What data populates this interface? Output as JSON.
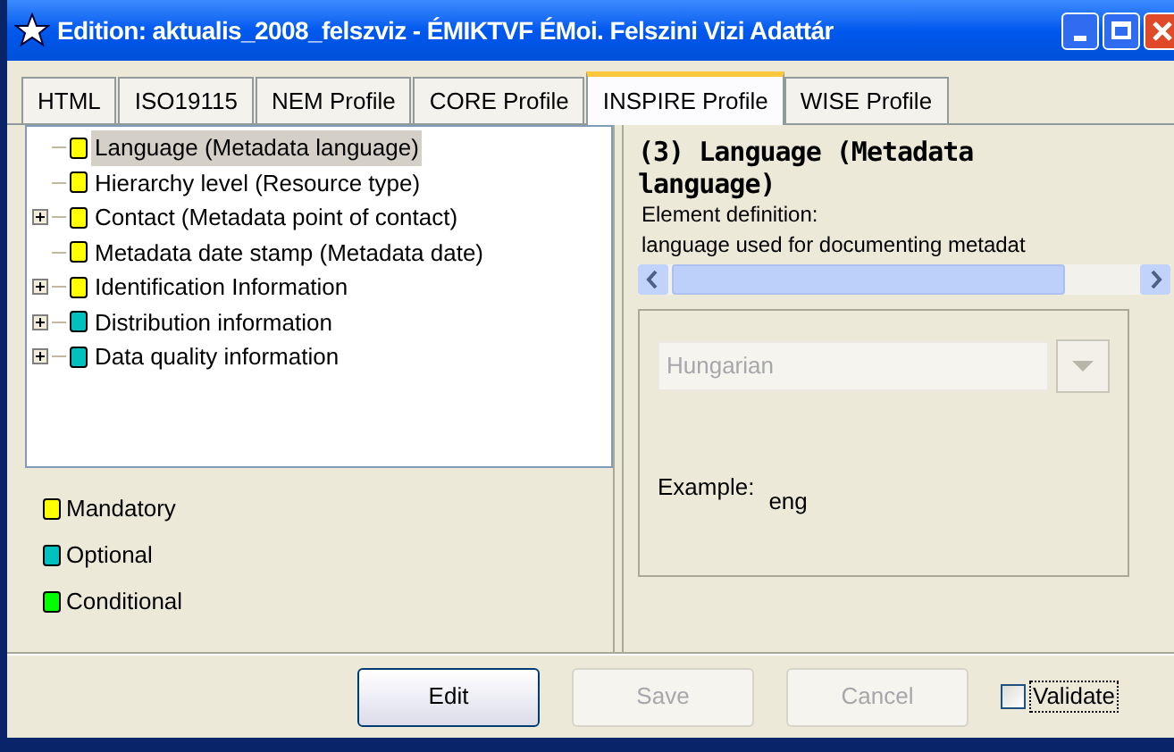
{
  "window": {
    "title": "Edition: aktualis_2008_felszviz - ÉMIKTVF ÉMoi. Felszini Vizi Adattár"
  },
  "tabs": [
    {
      "label": "HTML",
      "selected": false
    },
    {
      "label": "ISO19115",
      "selected": false
    },
    {
      "label": "NEM Profile",
      "selected": false
    },
    {
      "label": "CORE Profile",
      "selected": false
    },
    {
      "label": "INSPIRE Profile",
      "selected": true
    },
    {
      "label": "WISE Profile",
      "selected": false
    }
  ],
  "tree": [
    {
      "label": "Language (Metadata language)",
      "color": "#ffff00",
      "collapsed": false,
      "selected": true
    },
    {
      "label": "Hierarchy level (Resource type)",
      "color": "#ffff00",
      "collapsed": false,
      "selected": false
    },
    {
      "label": "Contact (Metadata point of contact)",
      "color": "#ffff00",
      "collapsed": true,
      "selected": false
    },
    {
      "label": "Metadata date stamp (Metadata date)",
      "color": "#ffff00",
      "collapsed": false,
      "selected": false
    },
    {
      "label": "Identification Information",
      "color": "#ffff00",
      "collapsed": true,
      "selected": false
    },
    {
      "label": "Distribution information",
      "color": "#00c0c0",
      "collapsed": true,
      "selected": false
    },
    {
      "label": "Data quality information",
      "color": "#00c0c0",
      "collapsed": true,
      "selected": false
    }
  ],
  "legend": [
    {
      "label": "Mandatory",
      "color": "#ffff00"
    },
    {
      "label": "Optional",
      "color": "#00c0c0"
    },
    {
      "label": "Conditional",
      "color": "#00ff00"
    }
  ],
  "detail": {
    "heading": "(3) Language (Metadata language)",
    "definition_label": "Element definition:",
    "definition": "language used for documenting metadat",
    "select": {
      "value": "Hungarian",
      "disabled": true
    },
    "example_label": "Example:",
    "example": "eng"
  },
  "buttons": [
    {
      "label": "Edit",
      "disabled": false
    },
    {
      "label": "Save",
      "disabled": true
    },
    {
      "label": "Cancel",
      "disabled": true
    }
  ],
  "validate": {
    "label": "Validate",
    "checked": false
  }
}
